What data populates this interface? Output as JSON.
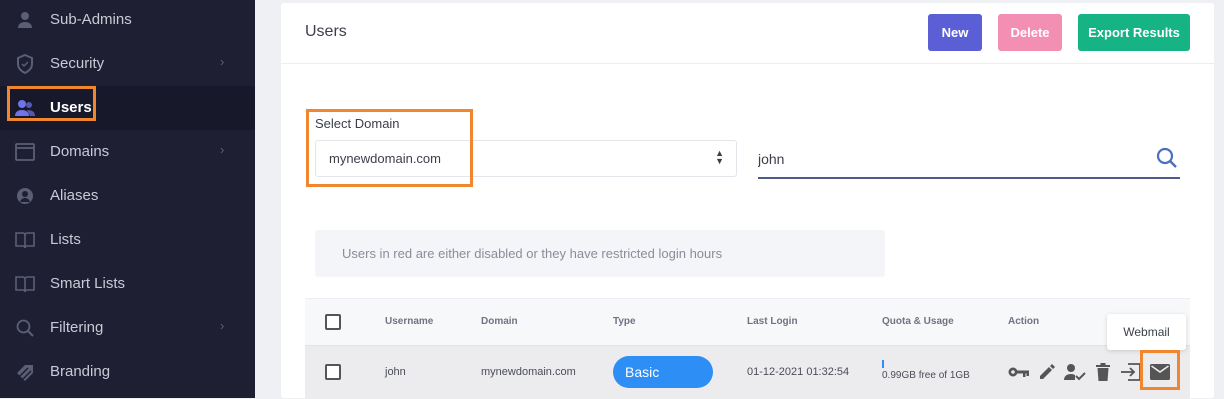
{
  "sidebar": {
    "items": [
      {
        "label": "Sub-Admins",
        "icon": "person-icon"
      },
      {
        "label": "Security",
        "icon": "shield-icon",
        "has_submenu": true
      },
      {
        "label": "Users",
        "icon": "users-icon",
        "active": true
      },
      {
        "label": "Domains",
        "icon": "window-icon",
        "has_submenu": true
      },
      {
        "label": "Aliases",
        "icon": "alias-icon"
      },
      {
        "label": "Lists",
        "icon": "book-icon"
      },
      {
        "label": "Smart Lists",
        "icon": "book-icon"
      },
      {
        "label": "Filtering",
        "icon": "search-icon",
        "has_submenu": true
      },
      {
        "label": "Branding",
        "icon": "brand-icon"
      }
    ],
    "chevron": "›"
  },
  "card": {
    "title": "Users",
    "buttons": {
      "new": "New",
      "delete": "Delete",
      "export": "Export Results"
    }
  },
  "filter": {
    "domain_label": "Select Domain",
    "domain_value": "mynewdomain.com",
    "search_value": "john"
  },
  "info_text": "Users in red are either disabled or they have restricted login hours",
  "table": {
    "headers": {
      "username": "Username",
      "domain": "Domain",
      "type": "Type",
      "last_login": "Last Login",
      "quota": "Quota & Usage",
      "action": "Action"
    },
    "rows": [
      {
        "username": "john",
        "domain": "mynewdomain.com",
        "type": "Basic",
        "last_login": "01-12-2021 01:32:54",
        "quota": "0.99GB free of 1GB",
        "quota_used_fraction": 0.01
      }
    ],
    "action_icons": [
      "key-icon",
      "edit-icon",
      "user-check-icon",
      "trash-icon",
      "sign-in-icon",
      "webmail-icon"
    ]
  },
  "tooltip": "Webmail",
  "colors": {
    "sidebar_bg": "#1e1f33",
    "accent_highlight": "#f0862e",
    "new_button": "#5b5fd6",
    "delete_button": "#f48fb4",
    "export_button": "#16b384",
    "badge": "#2d8ef5"
  }
}
